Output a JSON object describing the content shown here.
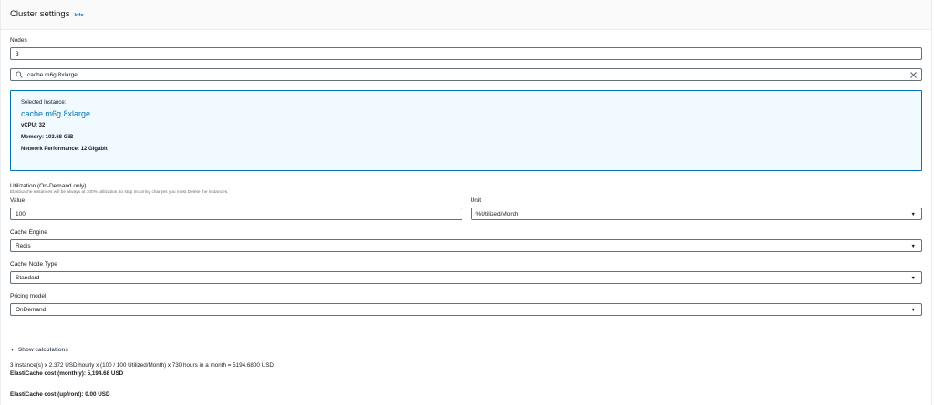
{
  "header": {
    "title": "Cluster settings",
    "info": "Info"
  },
  "nodes": {
    "label": "Nodes",
    "value": "3"
  },
  "instance_search": {
    "value": "cache.m6g.8xlarge"
  },
  "selected": {
    "label": "Selected Instance:",
    "name": "cache.m6g.8xlarge",
    "vcpu": "vCPU: 32",
    "memory": "Memory: 103.68 GiB",
    "network": "Network Performance: 12 Gigabit"
  },
  "utilization": {
    "label": "Utilization (On-Demand only)",
    "hint": "Elasticache Instances will be always at 100% utilization, to stop incurring charges you must Delete the instances.",
    "value_label": "Value",
    "value": "100",
    "unit_label": "Unit",
    "unit": "%Utilized/Month"
  },
  "cache_engine": {
    "label": "Cache Engine",
    "value": "Redis"
  },
  "cache_node_type": {
    "label": "Cache Node Type",
    "value": "Standard"
  },
  "pricing_model": {
    "label": "Pricing model",
    "value": "OnDemand"
  },
  "calculations": {
    "toggle": "Show calculations",
    "formula": "3 instance(s) x 2.372 USD hourly x (100 / 100 Utilized/Month) x 730 hours in a month = 5194.6800 USD",
    "monthly": "ElastiCache cost (monthly): 5,194.68 USD",
    "upfront": "ElastiCache cost (upfront): 0.00 USD"
  },
  "icons": {
    "search": "search-icon",
    "clear": "close-icon",
    "caret": "caret-down-icon",
    "expand": "caret-down-icon"
  }
}
